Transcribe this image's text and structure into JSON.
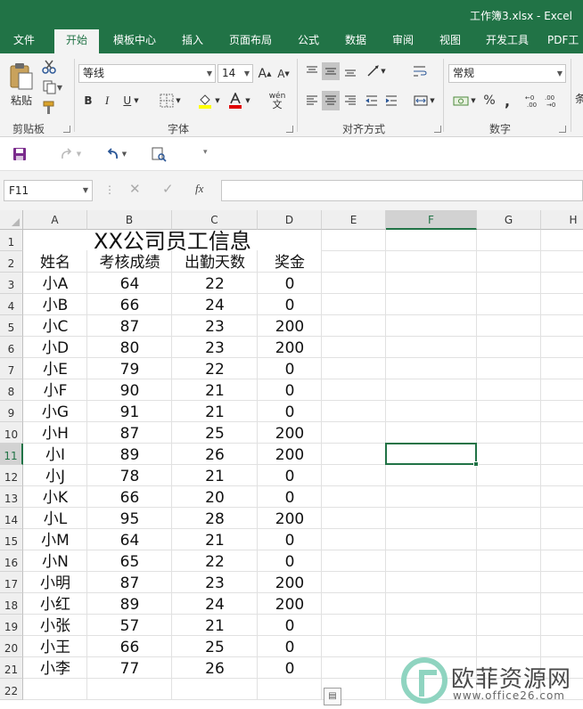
{
  "window": {
    "title": "工作簿3.xlsx - Excel"
  },
  "tabs": [
    "文件",
    "开始",
    "模板中心",
    "插入",
    "页面布局",
    "公式",
    "数据",
    "审阅",
    "视图",
    "开发工具",
    "PDF工"
  ],
  "ribbon": {
    "clipboard": {
      "label": "剪贴板",
      "paste": "粘贴"
    },
    "font": {
      "label": "字体",
      "name": "等线",
      "size": "14",
      "bold": "B",
      "italic": "I",
      "underline": "U",
      "grow": "A",
      "shrink": "A",
      "phonetic": "wén"
    },
    "alignment": {
      "label": "对齐方式"
    },
    "number": {
      "label": "数字",
      "format": "常规",
      "percent": "%",
      "comma": ","
    },
    "cut_off_label": "条"
  },
  "formula_bar": {
    "name_box": "F11",
    "fx": "fx",
    "value": ""
  },
  "columns": [
    "A",
    "B",
    "C",
    "D",
    "E",
    "F",
    "G",
    "H"
  ],
  "selected_col": "F",
  "selected_row": "11",
  "rows": [
    "1",
    "2",
    "3",
    "4",
    "5",
    "6",
    "7",
    "8",
    "9",
    "10",
    "11",
    "12",
    "13",
    "14",
    "15",
    "16",
    "17",
    "18",
    "19",
    "20",
    "21",
    "22"
  ],
  "sheet": {
    "title": "XX公司员工信息",
    "headers": [
      "姓名",
      "考核成绩",
      "出勤天数",
      "奖金"
    ],
    "records": [
      [
        "小A",
        "64",
        "22",
        "0"
      ],
      [
        "小B",
        "66",
        "24",
        "0"
      ],
      [
        "小C",
        "87",
        "23",
        "200"
      ],
      [
        "小D",
        "80",
        "23",
        "200"
      ],
      [
        "小E",
        "79",
        "22",
        "0"
      ],
      [
        "小F",
        "90",
        "21",
        "0"
      ],
      [
        "小G",
        "91",
        "21",
        "0"
      ],
      [
        "小H",
        "87",
        "25",
        "200"
      ],
      [
        "小I",
        "89",
        "26",
        "200"
      ],
      [
        "小J",
        "78",
        "21",
        "0"
      ],
      [
        "小K",
        "66",
        "20",
        "0"
      ],
      [
        "小L",
        "95",
        "28",
        "200"
      ],
      [
        "小M",
        "64",
        "21",
        "0"
      ],
      [
        "小N",
        "65",
        "22",
        "0"
      ],
      [
        "小明",
        "87",
        "23",
        "200"
      ],
      [
        "小红",
        "89",
        "24",
        "200"
      ],
      [
        "小张",
        "57",
        "21",
        "0"
      ],
      [
        "小王",
        "66",
        "25",
        "0"
      ],
      [
        "小李",
        "77",
        "26",
        "0"
      ]
    ]
  },
  "watermark": {
    "text": "欧菲资源网",
    "url": "www.office26.com"
  },
  "colors": {
    "accent": "#217346"
  }
}
